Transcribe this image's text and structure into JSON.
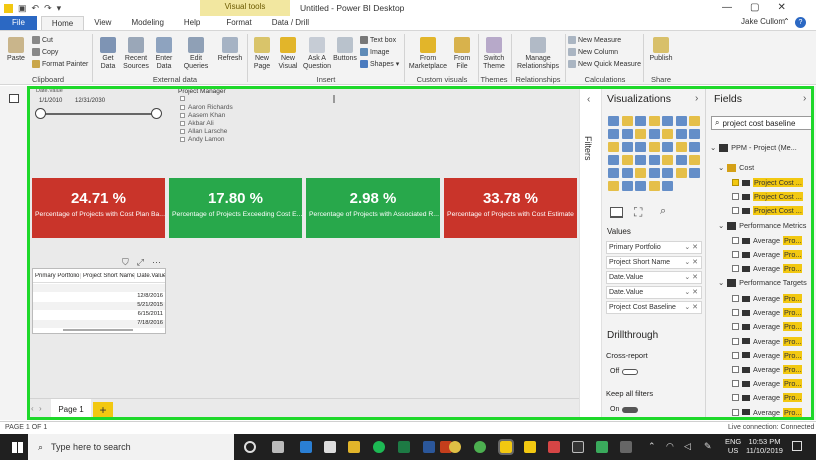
{
  "titlebar": {
    "visual_tools": "Visual tools",
    "title": "Untitled - Power BI Desktop",
    "user": "Jake Cullom",
    "minimize": "—",
    "maximize": "▢",
    "close": "✕"
  },
  "tabs": [
    "File",
    "Home",
    "View",
    "Modeling",
    "Help",
    "Format",
    "Data / Drill"
  ],
  "ribbon": {
    "clipboard": {
      "paste": "Paste",
      "cut": "Cut",
      "copy": "Copy",
      "format_painter": "Format Painter",
      "label": "Clipboard"
    },
    "external": {
      "get_data": "Get\nData",
      "recent_sources": "Recent\nSources",
      "enter_data": "Enter\nData",
      "edit_queries": "Edit\nQueries",
      "refresh": "Refresh",
      "label": "External data"
    },
    "insert": {
      "new_page": "New\nPage",
      "new_visual": "New\nVisual",
      "ask_question": "Ask A\nQuestion",
      "buttons": "Buttons",
      "text_box": "Text box",
      "image": "Image",
      "shapes": "Shapes",
      "label": "Insert"
    },
    "custom": {
      "from_marketplace": "From\nMarketplace",
      "from_file": "From\nFile",
      "label": "Custom visuals"
    },
    "themes": {
      "switch_theme": "Switch\nTheme",
      "label": "Themes"
    },
    "relationships": {
      "manage": "Manage\nRelationships",
      "label": "Relationships"
    },
    "calculations": {
      "new_measure": "New Measure",
      "new_column": "New Column",
      "new_quick_measure": "New Quick Measure",
      "label": "Calculations"
    },
    "share": {
      "publish": "Publish",
      "label": "Share"
    }
  },
  "canvas": {
    "slicer": {
      "title": "Date.Value",
      "start": "1/1/2010",
      "end": "12/31/2030"
    },
    "project_manager": {
      "title": "Project Manager",
      "items": [
        "",
        "Aaron Richards",
        "Aasem Khan",
        "Akbar Ali",
        "Allan Larsche",
        "Andy Lamon"
      ]
    },
    "cards": [
      {
        "value": "24.71 %",
        "label": "Percentage of Projects with Cost Plan Ba..."
      },
      {
        "value": "17.80 %",
        "label": "Percentage of Projects Exceeding Cost E..."
      },
      {
        "value": "2.98 %",
        "label": "Percentage of Projects with Associated R..."
      },
      {
        "value": "33.78 %",
        "label": "Percentage of Projects with Cost Estimate"
      }
    ],
    "table": {
      "headers": [
        "Primary Portfolio",
        "Project Short Name",
        "Date.Value"
      ],
      "rows": [
        "",
        "12/8/2016",
        "5/21/2015",
        "6/15/2011",
        "7/18/2016"
      ]
    }
  },
  "pagebar": {
    "page1": "Page 1",
    "add": "+"
  },
  "filters": {
    "label": "Filters"
  },
  "visualizations": {
    "title": "Visualizations",
    "values_label": "Values",
    "wells": [
      "Primary Portfolio",
      "Project Short Name",
      "Date.Value",
      "Date.Value",
      "Project Cost Baseline"
    ],
    "drillthrough": "Drillthrough",
    "cross_report": "Cross-report",
    "cross_off": "Off",
    "keep_filters": "Keep all filters",
    "keep_on": "On"
  },
  "fields": {
    "title": "Fields",
    "search_value": "project cost baseline",
    "model": "PPM - Project (Me...",
    "cost_group": "Cost",
    "cost_items": [
      "Project Cost ...",
      "Project Cost ...",
      "Project Cost ..."
    ],
    "metrics_group": "Performance Metrics",
    "metrics_items": [
      "Pro...",
      "Pro...",
      "Pro..."
    ],
    "targets_group": "Performance Targets",
    "targets_items": [
      "Pro...",
      "Pro...",
      "Pro...",
      "Pro...",
      "Pro...",
      "Pro...",
      "Pro...",
      "Pro...",
      "Pro..."
    ],
    "average_prefix": "Average"
  },
  "status": {
    "page": "PAGE 1 OF 1",
    "connection": "Live connection: Connected"
  },
  "taskbar": {
    "search": "Type here to search",
    "lang": "ENG",
    "region": "US",
    "time": "10:53 PM",
    "date": "11/10/2019"
  },
  "colors": {
    "red": "#c9342a",
    "green": "#28a84b",
    "yellow": "#f2c811",
    "frame": "#1ed82a",
    "file_tab": "#2b68c3"
  }
}
